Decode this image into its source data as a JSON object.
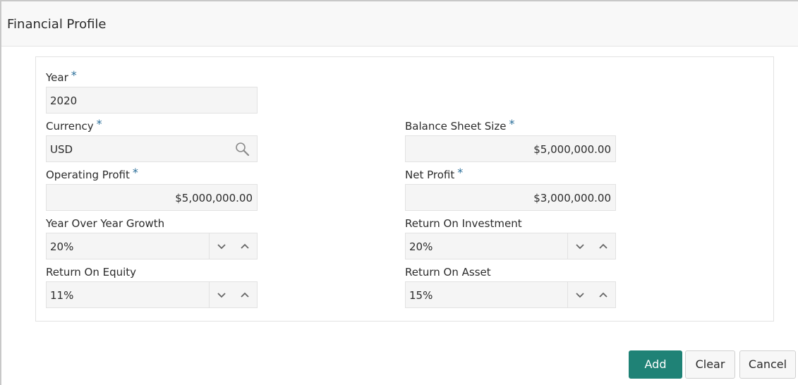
{
  "header": {
    "title": "Financial Profile"
  },
  "form": {
    "year": {
      "label": "Year",
      "required": "*",
      "value": "2020"
    },
    "currency": {
      "label": "Currency",
      "required": "*",
      "value": "USD"
    },
    "balance_sheet_size": {
      "label": "Balance Sheet Size",
      "required": "*",
      "value": "$5,000,000.00"
    },
    "operating_profit": {
      "label": "Operating Profit",
      "required": "*",
      "value": "$5,000,000.00"
    },
    "net_profit": {
      "label": "Net Profit",
      "required": "*",
      "value": "$3,000,000.00"
    },
    "yoy_growth": {
      "label": "Year Over Year Growth",
      "value": "20%"
    },
    "roi": {
      "label": "Return On Investment",
      "value": "20%"
    },
    "roe": {
      "label": "Return On Equity",
      "value": "11%"
    },
    "roa": {
      "label": "Return On Asset",
      "value": "15%"
    }
  },
  "actions": {
    "add": "Add",
    "clear": "Clear",
    "cancel": "Cancel"
  },
  "colors": {
    "accent": "#1f8276",
    "required": "#2a6e99",
    "field_bg": "#f5f5f5"
  },
  "icons": {
    "search": "search-icon",
    "down": "chevron-down-icon",
    "up": "chevron-up-icon"
  }
}
